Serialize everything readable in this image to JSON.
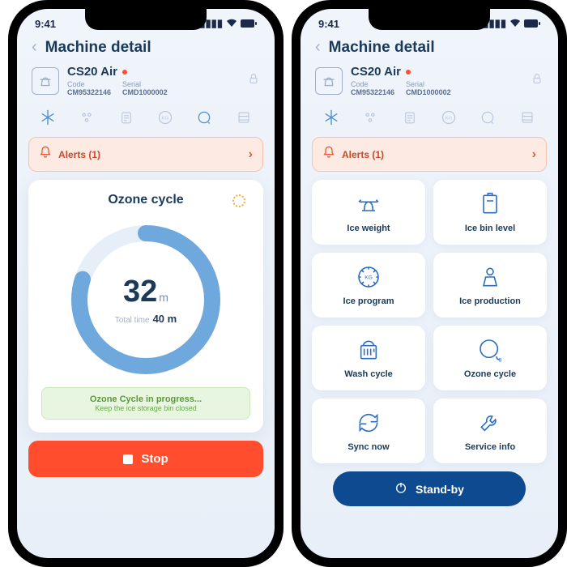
{
  "statusbar": {
    "time": "9:41"
  },
  "header": {
    "title": "Machine detail"
  },
  "machine": {
    "name": "CS20 Air",
    "code_label": "Code",
    "code": "CM95322146",
    "serial_label": "Serial",
    "serial": "CMD1000002"
  },
  "alerts": {
    "label": "Alerts (1)"
  },
  "ozone": {
    "title": "Ozone cycle",
    "value": "32",
    "unit": "m",
    "total_label": "Total time",
    "total_value": "40",
    "total_unit": "m",
    "progress_pct": 80,
    "note_l1": "Ozone Cycle in progress...",
    "note_l2": "Keep the ice storage bin closed"
  },
  "buttons": {
    "stop": "Stop",
    "standby": "Stand-by"
  },
  "tiles": [
    {
      "label": "Ice weight"
    },
    {
      "label": "Ice bin level"
    },
    {
      "label": "Ice program"
    },
    {
      "label": "Ice production"
    },
    {
      "label": "Wash cycle"
    },
    {
      "label": "Ozone cycle"
    },
    {
      "label": "Sync now"
    },
    {
      "label": "Service info"
    }
  ],
  "colors": {
    "accent": "#4a8fd6",
    "danger": "#ff4d2e",
    "primary_dark": "#0d4a8f",
    "text": "#1b3a5a"
  }
}
